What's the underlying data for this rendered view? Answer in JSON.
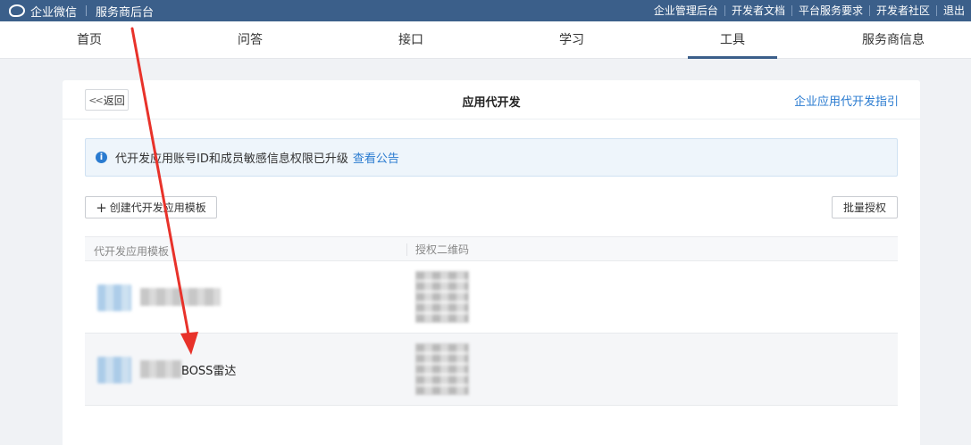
{
  "topbar": {
    "brand": "企业微信",
    "subtitle": "服务商后台",
    "links": [
      "企业管理后台",
      "开发者文档",
      "平台服务要求",
      "开发者社区",
      "退出"
    ]
  },
  "nav": {
    "tabs": [
      "首页",
      "问答",
      "接口",
      "学习",
      "工具",
      "服务商信息"
    ],
    "active": "工具"
  },
  "page": {
    "back_label": "返回",
    "title": "应用代开发",
    "guide_link": "企业应用代开发指引"
  },
  "notice": {
    "text": "代开发应用账号ID和成员敏感信息权限已升级",
    "link": "查看公告"
  },
  "actions": {
    "create_label": "创建代开发应用模板",
    "batch_label": "批量授权"
  },
  "table": {
    "headers": [
      "代开发应用模板",
      "授权二维码"
    ],
    "rows": [
      {
        "name": ""
      },
      {
        "name": "BOSS雷达"
      }
    ]
  },
  "colors": {
    "topbar": "#3b5f8a",
    "link": "#2a7bd0",
    "annotation_arrow": "#e8322a"
  },
  "icons": [
    "wecom-logo-icon",
    "chevron-double-left-icon",
    "info-icon",
    "plus-icon",
    "red-arrow-annotation"
  ]
}
